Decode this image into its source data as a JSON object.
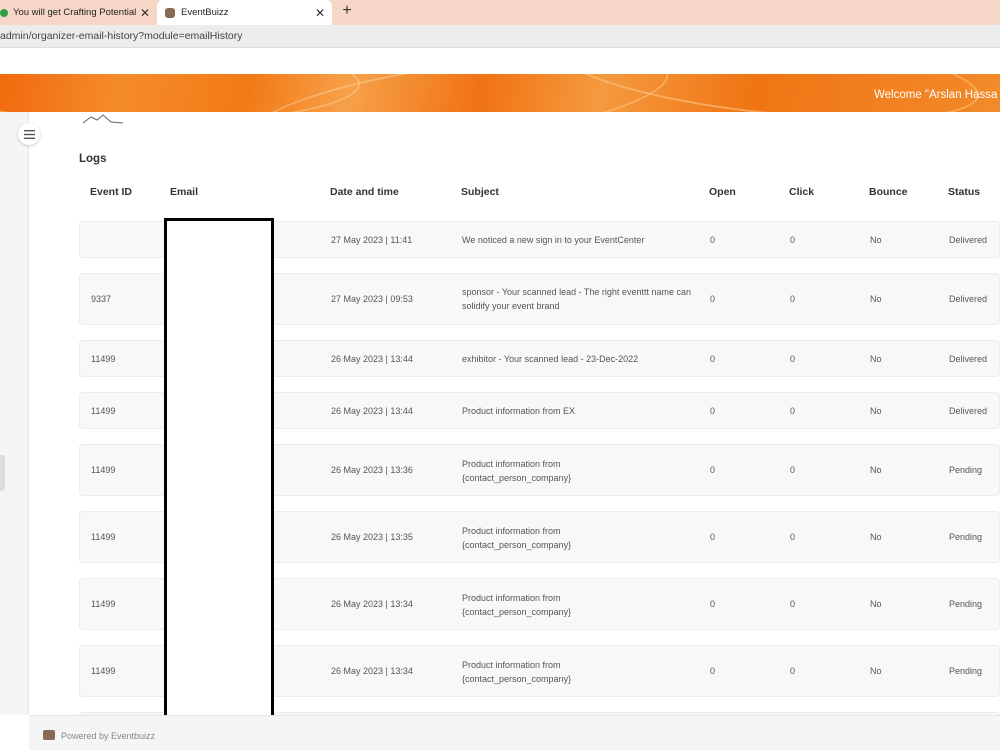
{
  "browser": {
    "tabs": [
      {
        "title": "You will get Crafting Potential of",
        "close": "✕"
      },
      {
        "title": "EventBuizz",
        "close": "✕"
      }
    ],
    "new_tab": "+",
    "url": "admin/organizer-email-history?module=emailHistory"
  },
  "header": {
    "welcome": "Welcome \"Arslan Hassa"
  },
  "main": {
    "title": "Logs",
    "columns": [
      "Event ID",
      "Email",
      "Date and time",
      "Subject",
      "Open",
      "Click",
      "Bounce",
      "Status"
    ],
    "rows": [
      {
        "event_id": "",
        "date": "27 May 2023 | 11:41",
        "subject": "We noticed a new sign in to your EventCenter",
        "open": "0",
        "click": "0",
        "bounce": "No",
        "status": "Delivered"
      },
      {
        "event_id": "9337",
        "date": "27 May 2023 | 09:53",
        "subject": "sponsor - Your scanned lead - The right eventtt name can solidify your event brand",
        "open": "0",
        "click": "0",
        "bounce": "No",
        "status": "Delivered"
      },
      {
        "event_id": "11499",
        "date": "26 May 2023 | 13:44",
        "subject": "exhibitor - Your scanned lead - 23-Dec-2022",
        "open": "0",
        "click": "0",
        "bounce": "No",
        "status": "Delivered"
      },
      {
        "event_id": "11499",
        "date": "26 May 2023 | 13:44",
        "subject": "Product information from EX",
        "open": "0",
        "click": "0",
        "bounce": "No",
        "status": "Delivered"
      },
      {
        "event_id": "11499",
        "date": "26 May 2023 | 13:36",
        "subject": "Product information from {contact_person_company}",
        "open": "0",
        "click": "0",
        "bounce": "No",
        "status": "Pending"
      },
      {
        "event_id": "11499",
        "date": "26 May 2023 | 13:35",
        "subject": "Product information from {contact_person_company}",
        "open": "0",
        "click": "0",
        "bounce": "No",
        "status": "Pending"
      },
      {
        "event_id": "11499",
        "date": "26 May 2023 | 13:34",
        "subject": "Product information from {contact_person_company}",
        "open": "0",
        "click": "0",
        "bounce": "No",
        "status": "Pending"
      },
      {
        "event_id": "11499",
        "date": "26 May 2023 | 13:34",
        "subject": "Product information from {contact_person_company}",
        "open": "0",
        "click": "0",
        "bounce": "No",
        "status": "Pending"
      }
    ]
  },
  "footer": {
    "powered": "Powered by Eventbuizz"
  },
  "icons": {
    "menu": "menu-icon",
    "favicon": "eventbuizz-favicon-icon"
  },
  "colors": {
    "header_orange": "#f27a16",
    "tabbar": "#f6d6c6"
  }
}
